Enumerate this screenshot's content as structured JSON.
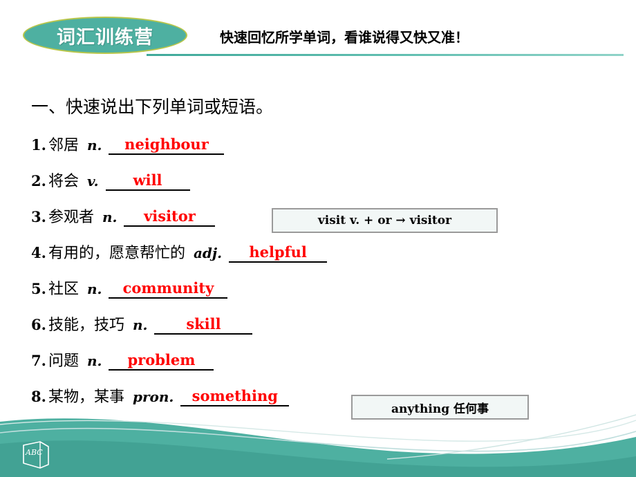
{
  "header": {
    "badge_label": "词汇训练营",
    "subtitle": "快速回忆所学单词，看谁说得又快又准！",
    "badge_fill": "#4eb0a1",
    "badge_border": "#b9c64a",
    "rule_color": "#4eb0a1"
  },
  "main": {
    "section_title": "一、快速说出下列单词或短语。",
    "answer_color": "#ff0000",
    "items": [
      {
        "num": "1.",
        "zh": "邻居",
        "pos": "n.",
        "answer": "neighbour"
      },
      {
        "num": "2.",
        "zh": "将会",
        "pos": "v.",
        "answer": "will"
      },
      {
        "num": "3.",
        "zh": "参观者",
        "pos": "n.",
        "answer": "visitor"
      },
      {
        "num": "4.",
        "zh": "有用的，愿意帮忙的",
        "pos": "adj.",
        "answer": "helpful"
      },
      {
        "num": "5.",
        "zh": "社区",
        "pos": "n.",
        "answer": "community"
      },
      {
        "num": "6.",
        "zh": "技能，技巧",
        "pos": "n.",
        "answer": "skill"
      },
      {
        "num": "7.",
        "zh": "问题",
        "pos": "n.",
        "answer": "problem"
      },
      {
        "num": "8.",
        "zh": "某物，某事",
        "pos": "pron.",
        "answer": "something"
      }
    ]
  },
  "callouts": {
    "visitor_note": {
      "word": "visit",
      "pos": "v.",
      "rule": "+ or → visitor",
      "full_text": "visit v. + or → visitor"
    },
    "anything_note": {
      "full_text": "anything 任何事"
    }
  },
  "footer": {
    "logo_text": "ABC",
    "wave_color": "#4eb0a1",
    "wave_color_dark": "#3f9e90",
    "wave_line_color": "#bfdedd"
  }
}
